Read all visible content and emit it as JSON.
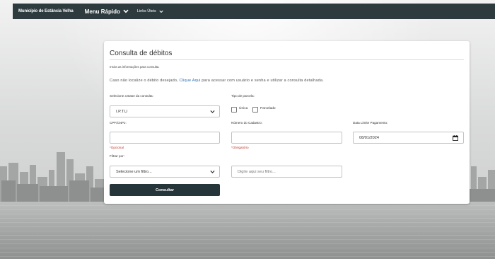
{
  "nav": {
    "brand": "Município de Estância Velha",
    "menu_rapido": "Menu Rápido",
    "links_uteis": "Links Úteis"
  },
  "card": {
    "title": "Consulta de débitos",
    "hint": "Insira as informações para consulta.",
    "notice_before": "Caso não localize o débito desejado, ",
    "notice_link": "Clique Aqui",
    "notice_after": " para acessar com usuário e senha e utilizar a consulta detalhada."
  },
  "form": {
    "base_label": "Selecione a Base da consulta:",
    "base_value": "I.P.T.U",
    "parcela_label": "Tipo de parcela:",
    "parcela_options": [
      "Única",
      "Parcelado"
    ],
    "cpf_label": "CPF/CNPJ:",
    "cpf_value": "",
    "cpf_note": "*Opcional",
    "cadastro_label": "Número do Cadastro:",
    "cadastro_value": "",
    "cadastro_note": "*Obrigatório",
    "data_label": "Data Limite Pagamento:",
    "data_value": "08/01/2024",
    "filtro_label": "Filtrar por:",
    "filtro_value": "Selecione um filtro...",
    "filtro_input_placeholder": "Digite aqui seu filtro...",
    "submit_label": "Consultar"
  },
  "colors": {
    "nav_bg": "#2d3b3f",
    "button_bg": "#26353a",
    "link": "#2a6fb0",
    "required": "#c0392b"
  },
  "icons": [
    "chevron-down-icon",
    "calendar-icon"
  ]
}
